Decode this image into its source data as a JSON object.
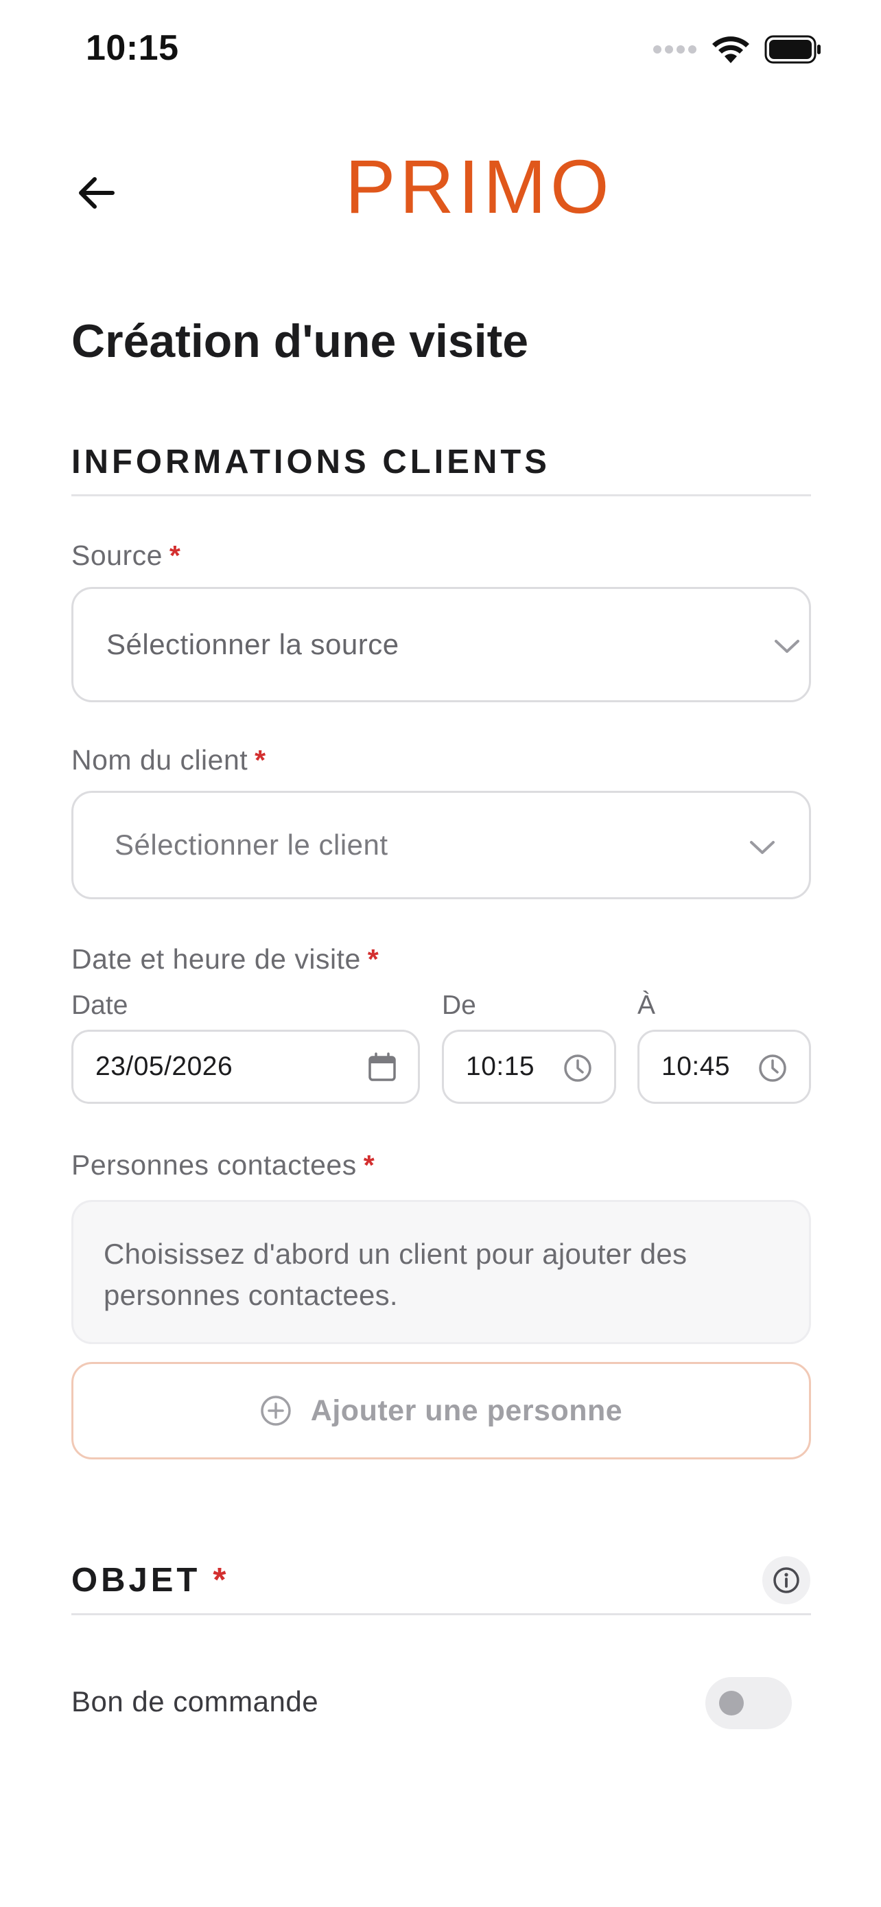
{
  "status_bar": {
    "time": "10:15"
  },
  "header": {
    "logo_text": "PRIMO",
    "back_icon": "arrow-left-icon"
  },
  "page": {
    "title": "Création d'une visite"
  },
  "section_clients": {
    "title": "INFORMATIONS CLIENTS",
    "source": {
      "label": "Source",
      "required_mark": "*",
      "placeholder": "Sélectionner la source"
    },
    "client": {
      "label": "Nom du client",
      "required_mark": "*",
      "placeholder": "Sélectionner le client"
    },
    "datetime": {
      "label": "Date et heure de visite",
      "required_mark": "*",
      "date_label": "Date",
      "date_value": "23/05/2026",
      "from_label": "De",
      "from_value": "10:15",
      "to_label": "À",
      "to_value": "10:45"
    },
    "contacts": {
      "label": "Personnes contactees",
      "required_mark": "*",
      "empty_message": "Choisissez d'abord un client pour ajouter des personnes contactees.",
      "add_button": "Ajouter une personne"
    }
  },
  "section_objet": {
    "title": "OBJET",
    "required_mark": "*",
    "toggle_label": "Bon de commande",
    "toggle_on": false
  },
  "colors": {
    "brand": "#e0571b",
    "required": "#d32f2f"
  }
}
